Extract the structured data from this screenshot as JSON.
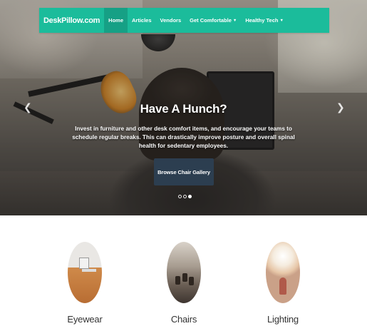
{
  "navbar": {
    "brand": "DeskPillow.com",
    "items": [
      {
        "label": "Home",
        "active": true
      },
      {
        "label": "Articles",
        "active": false
      },
      {
        "label": "Vendors",
        "active": false
      },
      {
        "label": "Get Comfortable",
        "dropdown": true
      },
      {
        "label": "Healthy Tech",
        "dropdown": true
      }
    ],
    "color": "#1bbc9b",
    "active_color": "#16a085"
  },
  "hero": {
    "title": "Have A Hunch?",
    "text": "Invest in furniture and other desk comfort items, and encourage your teams to schedule regular breaks. This can drastically improve posture and overall spinal health for sedentary employees.",
    "button_label": "Browse Chair Gallery",
    "button_color": "#2c3e50",
    "prev_icon": "chevron-left-icon",
    "next_icon": "chevron-right-icon",
    "slides": 3,
    "active_slide": 3
  },
  "features": [
    {
      "label": "Eyewear"
    },
    {
      "label": "Chairs"
    },
    {
      "label": "Lighting"
    }
  ]
}
